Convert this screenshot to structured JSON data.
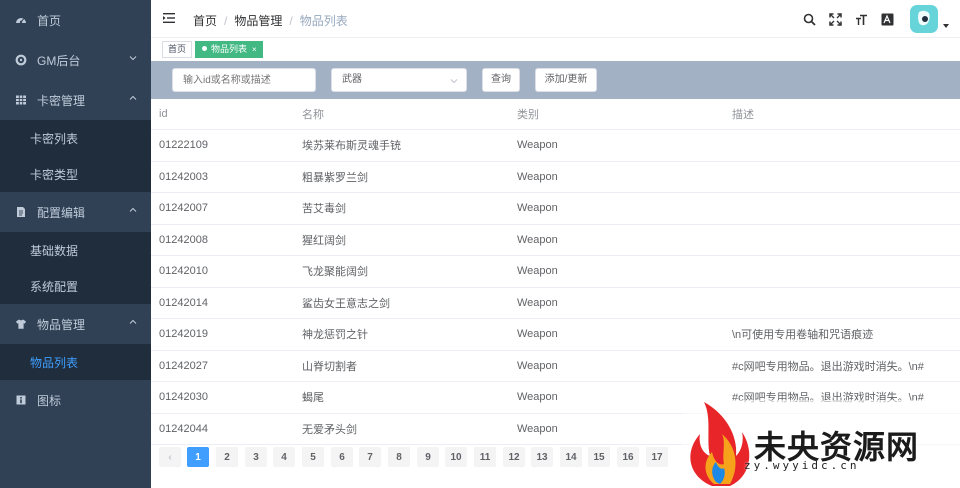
{
  "sidebar": {
    "items": [
      {
        "label": "首页",
        "icon": "dashboard-icon"
      },
      {
        "label": "GM后台",
        "icon": "settings-icon"
      },
      {
        "label": "卡密管理",
        "icon": "table-icon"
      },
      {
        "label": "配置编辑",
        "icon": "document-icon"
      },
      {
        "label": "物品管理",
        "icon": "shirt-icon"
      },
      {
        "label": "图标",
        "icon": "icon-icon"
      }
    ],
    "card_sub": [
      "卡密列表",
      "卡密类型"
    ],
    "config_sub": [
      "基础数据",
      "系统配置"
    ],
    "item_sub": [
      "物品列表"
    ]
  },
  "navbar": {
    "breadcrumb": [
      "首页",
      "物品管理",
      "物品列表"
    ],
    "separator": "/"
  },
  "tags": {
    "home": "首页",
    "active": "物品列表",
    "close": "×"
  },
  "filter": {
    "search_placeholder": "输入id或名称或描述",
    "select_value": "武器",
    "search_button": "查询",
    "add_button": "添加/更新"
  },
  "table": {
    "headers": [
      "id",
      "名称",
      "类别",
      "描述"
    ],
    "rows": [
      {
        "id": "01222109",
        "name": "埃苏莱布斯灵魂手铳",
        "type": "Weapon",
        "desc": ""
      },
      {
        "id": "01242003",
        "name": "粗暴紫罗兰剑",
        "type": "Weapon",
        "desc": ""
      },
      {
        "id": "01242007",
        "name": "苦艾毒剑",
        "type": "Weapon",
        "desc": ""
      },
      {
        "id": "01242008",
        "name": "猩红阔剑",
        "type": "Weapon",
        "desc": ""
      },
      {
        "id": "01242010",
        "name": "飞龙聚能阔剑",
        "type": "Weapon",
        "desc": ""
      },
      {
        "id": "01242014",
        "name": "鲨齿女王意志之剑",
        "type": "Weapon",
        "desc": ""
      },
      {
        "id": "01242019",
        "name": "神龙惩罚之针",
        "type": "Weapon",
        "desc": "\\n可使用专用卷轴和咒语痕迹"
      },
      {
        "id": "01242027",
        "name": "山脊切割者",
        "type": "Weapon",
        "desc": "#c网吧专用物品。退出游戏时消失。\\n#"
      },
      {
        "id": "01242030",
        "name": "蝎尾",
        "type": "Weapon",
        "desc": "#c网吧专用物品。退出游戏时消失。\\n#"
      },
      {
        "id": "01242044",
        "name": "无爱矛头剑",
        "type": "Weapon",
        "desc": ""
      }
    ]
  },
  "pagination": {
    "prev": "‹",
    "pages": [
      "1",
      "2",
      "3",
      "4",
      "5",
      "6",
      "7",
      "8",
      "9",
      "10",
      "11",
      "12",
      "13",
      "14",
      "15",
      "16",
      "17"
    ],
    "current": "1"
  },
  "watermark": {
    "title": "未央资源网",
    "url": "zy.wyyidc.cn"
  },
  "colors": {
    "sidebar_bg": "#304156",
    "submenu_bg": "#1f2d3d",
    "active_blue": "#409eff",
    "tag_green": "#42b983",
    "filter_bg": "#a3b1c4"
  }
}
